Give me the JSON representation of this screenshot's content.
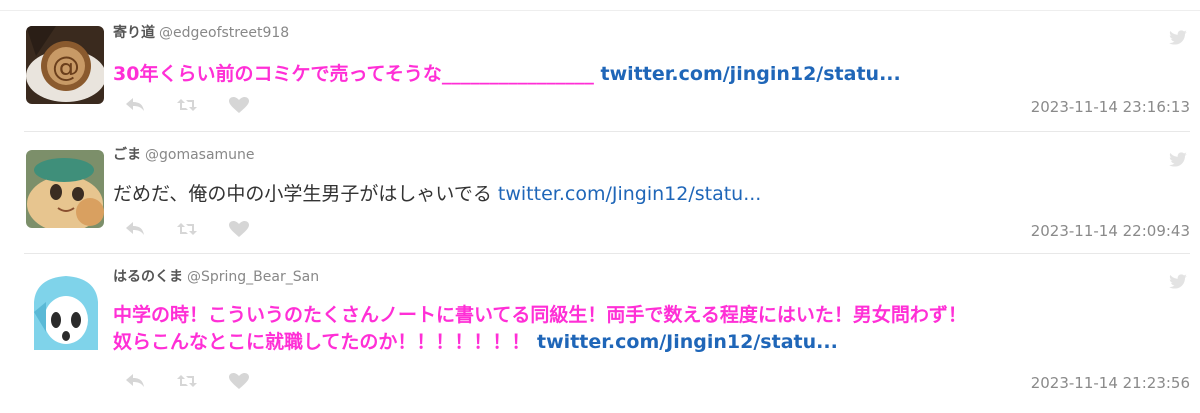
{
  "tweets": [
    {
      "display_name": "寄り道",
      "handle": "@edgeofstreet918",
      "line1": "30年くらい前のコミケで売ってそうな________________ ",
      "link": "twitter.com/jingin12/statu...",
      "timestamp": "2023-11-14 23:16:13",
      "highlight": true
    },
    {
      "display_name": "ごま",
      "handle": "@gomasamune",
      "line1": "だめだ、俺の中の小学生男子がはしゃいでる ",
      "link": "twitter.com/Jingin12/statu...",
      "timestamp": "2023-11-14 22:09:43",
      "highlight": false
    },
    {
      "display_name": "はるのくま",
      "handle": "@Spring_Bear_San",
      "line1": "中学の時！こういうのたくさんノートに書いてる同級生！両手で数える程度にはいた！男女問わず！",
      "line2": "奴らこんなとこに就職してたのか！！！！！！！ ",
      "link": "twitter.com/Jingin12/statu...",
      "timestamp": "2023-11-14 21:23:56",
      "highlight": true
    }
  ],
  "icons": {
    "reply": "reply-icon",
    "retweet": "retweet-icon",
    "like": "heart-icon",
    "platform": "twitter-bird-icon"
  },
  "colors": {
    "highlight_text": "#ff2fd6",
    "link": "#1f66b8",
    "timestamp": "#8a8a8a",
    "action_icons": "#d6d6d6"
  }
}
